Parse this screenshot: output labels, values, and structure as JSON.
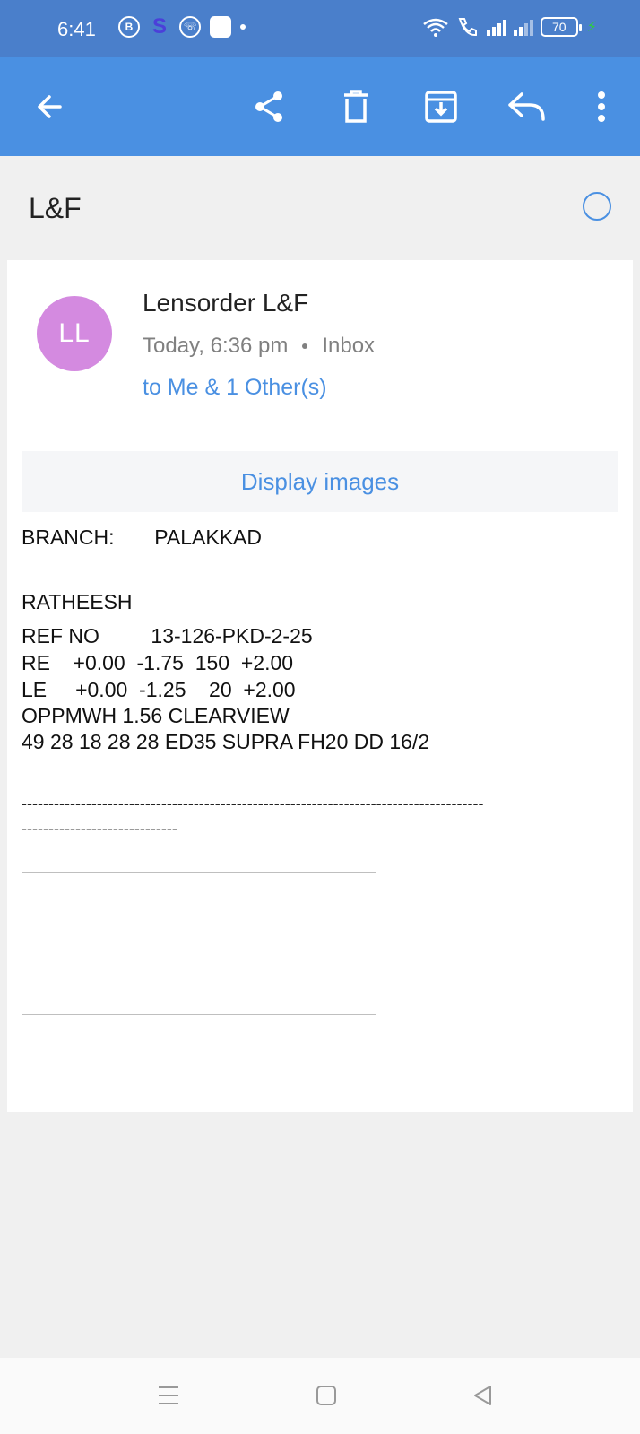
{
  "status_bar": {
    "time": "6:41",
    "battery": "70",
    "icons": [
      "b-icon",
      "s-icon",
      "chat-icon",
      "app-icon",
      "dot-icon",
      "wifi-icon",
      "call-icon",
      "signal-icon"
    ]
  },
  "toolbar": {
    "icons": [
      "back-arrow-icon",
      "share-icon",
      "delete-icon",
      "archive-icon",
      "reply-icon",
      "more-vert-icon"
    ],
    "color": "#4a90e2"
  },
  "email": {
    "subject": "L&F",
    "avatar_initials": "LL",
    "avatar_color": "#d48ae0",
    "sender": "Lensorder L&F",
    "date": "Today, 6:36 pm",
    "folder": "Inbox",
    "recipients": "to Me & 1 Other(s)",
    "display_images": "Display images",
    "body": {
      "branch_label": "BRANCH:",
      "branch_value": "PALAKKAD",
      "name": "RATHEESH",
      "ref_label": "REF NO",
      "ref_value": "13-126-PKD-2-25",
      "re_line": "RE    +0.00  -1.75  150  +2.00",
      "le_line": "LE     +0.00  -1.25    20  +2.00",
      "lens_line": "OPPMWH 1.56 CLEARVIEW",
      "frame_line": "49 28 18 28 28 ED35 SUPRA FH20 DD 16/2",
      "divider_1": "--------------------------------------------------------------------------------------",
      "divider_2": "-----------------------------"
    }
  },
  "nav_bar": {
    "icons": [
      "menu-icon",
      "home-icon",
      "back-icon"
    ]
  }
}
